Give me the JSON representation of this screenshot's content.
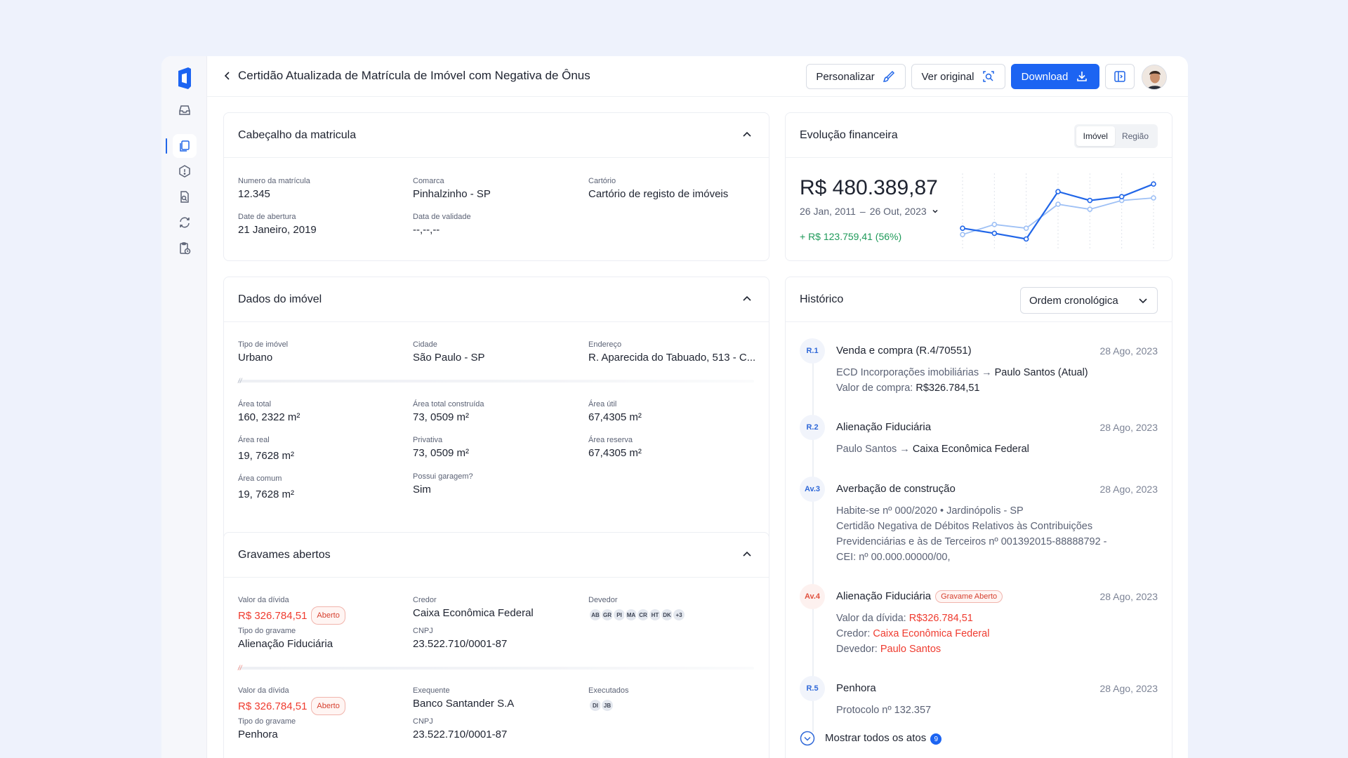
{
  "header": {
    "title": "Certidão Atualizada de Matrícula de Imóvel com Negativa de Ônus",
    "buttons": {
      "personalize": "Personalizar",
      "view_original": "Ver original",
      "download": "Download"
    }
  },
  "sidebar": {
    "items": [
      {
        "icon": "inbox-icon"
      },
      {
        "icon": "documents-icon",
        "active": true
      },
      {
        "icon": "shield-alert-icon"
      },
      {
        "icon": "file-search-icon"
      },
      {
        "icon": "refresh-icon"
      },
      {
        "icon": "clipboard-clock-icon"
      }
    ]
  },
  "cabecalho": {
    "title": "Cabeçalho da matricula",
    "fields": [
      {
        "label": "Numero da matrícula",
        "value": "12.345"
      },
      {
        "label": "Comarca",
        "value": "Pinhalzinho - SP"
      },
      {
        "label": "Cartório",
        "value": "Cartório de registo de imóveis"
      },
      {
        "label": "Date de abertura",
        "value": "21 Janeiro, 2019"
      },
      {
        "label": "Data de validade",
        "value": "--,--,--"
      }
    ]
  },
  "imovel": {
    "title": "Dados do imóvel",
    "fields": [
      {
        "label": "Tipo de imóvel",
        "value": "Urbano"
      },
      {
        "label": "Cidade",
        "value": "São Paulo - SP"
      },
      {
        "label": "Endereço",
        "value": "R. Aparecida do Tabuado, 513 - C..."
      },
      {
        "label": "Área total",
        "value": "160, 2322 m²"
      },
      {
        "label": "Área total construída",
        "value": "73, 0509 m²"
      },
      {
        "label": "Área útil",
        "value": "67,4305 m²"
      },
      {
        "label": "Área real",
        "value": "19, 7628 m²"
      },
      {
        "label": "Privativa",
        "value": "73, 0509 m²"
      },
      {
        "label": "Área reserva",
        "value": "67,4305 m²"
      },
      {
        "label": "Área comum",
        "value": "19, 7628 m²"
      },
      {
        "label": "Possui garagem?",
        "value": "Sim"
      }
    ]
  },
  "gravames": {
    "title": "Gravames abertos",
    "items": [
      {
        "debt_label": "Valor da dívida",
        "debt_value": "R$ 326.784,51",
        "status": "Aberto",
        "type_label": "Tipo do gravame",
        "type_value": "Alienação Fiduciária",
        "party_label": "Credor",
        "party_value": "Caixa Econômica Federal",
        "cnpj_label": "CNPJ",
        "cnpj_value": "23.522.710/0001-87",
        "people_label": "Devedor",
        "people": [
          "AB",
          "GR",
          "PI",
          "MA",
          "CR",
          "HT",
          "DK",
          "+3"
        ]
      },
      {
        "debt_label": "Valor da dívida",
        "debt_value": "R$ 326.784,51",
        "status": "Aberto",
        "type_label": "Tipo do gravame",
        "type_value": "Penhora",
        "party_label": "Exequente",
        "party_value": "Banco Santander S.A",
        "cnpj_label": "CNPJ",
        "cnpj_value": "23.522.710/0001-87",
        "people_label": "Executados",
        "people": [
          "DI",
          "JB"
        ]
      }
    ]
  },
  "financeiro": {
    "title": "Evolução financeira",
    "tabs": [
      "Imóvel",
      "Região"
    ],
    "amount": "R$ 480.389,87",
    "date_from": "26 Jan, 2011",
    "date_sep": "–",
    "date_to": "26 Out, 2023",
    "gain": "+ R$ 123.759,41 (56%)",
    "colors": {
      "primary": "#2166e8",
      "secondary": "#9ec0f5",
      "gain": "#1f9a5a"
    }
  },
  "chart_data": {
    "type": "line",
    "x": [
      1,
      2,
      3,
      4,
      5,
      6,
      7
    ],
    "series": [
      {
        "values": [
          22,
          14,
          5,
          80,
          66,
          72,
          92
        ]
      },
      {
        "values": [
          12,
          28,
          22,
          60,
          52,
          66,
          70
        ]
      }
    ],
    "ylim": [
      0,
      100
    ],
    "grid": "vertical-dashed"
  },
  "historico": {
    "title": "Histórico",
    "sort": "Ordem cronológica",
    "events": [
      {
        "badge": "R.1",
        "title": "Venda e compra (R.4/70551)",
        "date": "28 Ago, 2023",
        "from": "ECD Incorporações imobiliárias",
        "to": "Paulo Santos (Atual)",
        "price_label": "Valor de compra:",
        "price": "R$326.784,51"
      },
      {
        "badge": "R.2",
        "title": "Alienação Fiduciária",
        "date": "28 Ago, 2023",
        "from": "Paulo Santos",
        "to": "Caixa Econômica Federal"
      },
      {
        "badge": "Av.3",
        "title": "Averbação de construção",
        "date": "28 Ago, 2023",
        "lines": [
          "Habite-se nº 000/2020 • Jardinópolis - SP",
          "Certidão Negativa de Débitos Relativos às Contribuições",
          "Previdenciárias e às de Terceiros nº 001392015-88888792 -",
          "CEI: nº 00.000.00000/00,"
        ]
      },
      {
        "badge": "Av.4",
        "title": "Alienação Fiduciária",
        "tag": "Gravame Aberto",
        "date": "28 Ago, 2023",
        "debt_label": "Valor da dívida:",
        "debt": "R$326.784,51",
        "creditor_label": "Credor:",
        "creditor": "Caixa Econômica Federal",
        "debtor_label": "Devedor:",
        "debtor": "Paulo Santos"
      },
      {
        "badge": "R.5",
        "title": "Penhora",
        "date": "28 Ago, 2023",
        "line": "Protocolo nº 132.357"
      }
    ],
    "show_all": "Mostrar todos os atos",
    "show_all_count": "9"
  }
}
